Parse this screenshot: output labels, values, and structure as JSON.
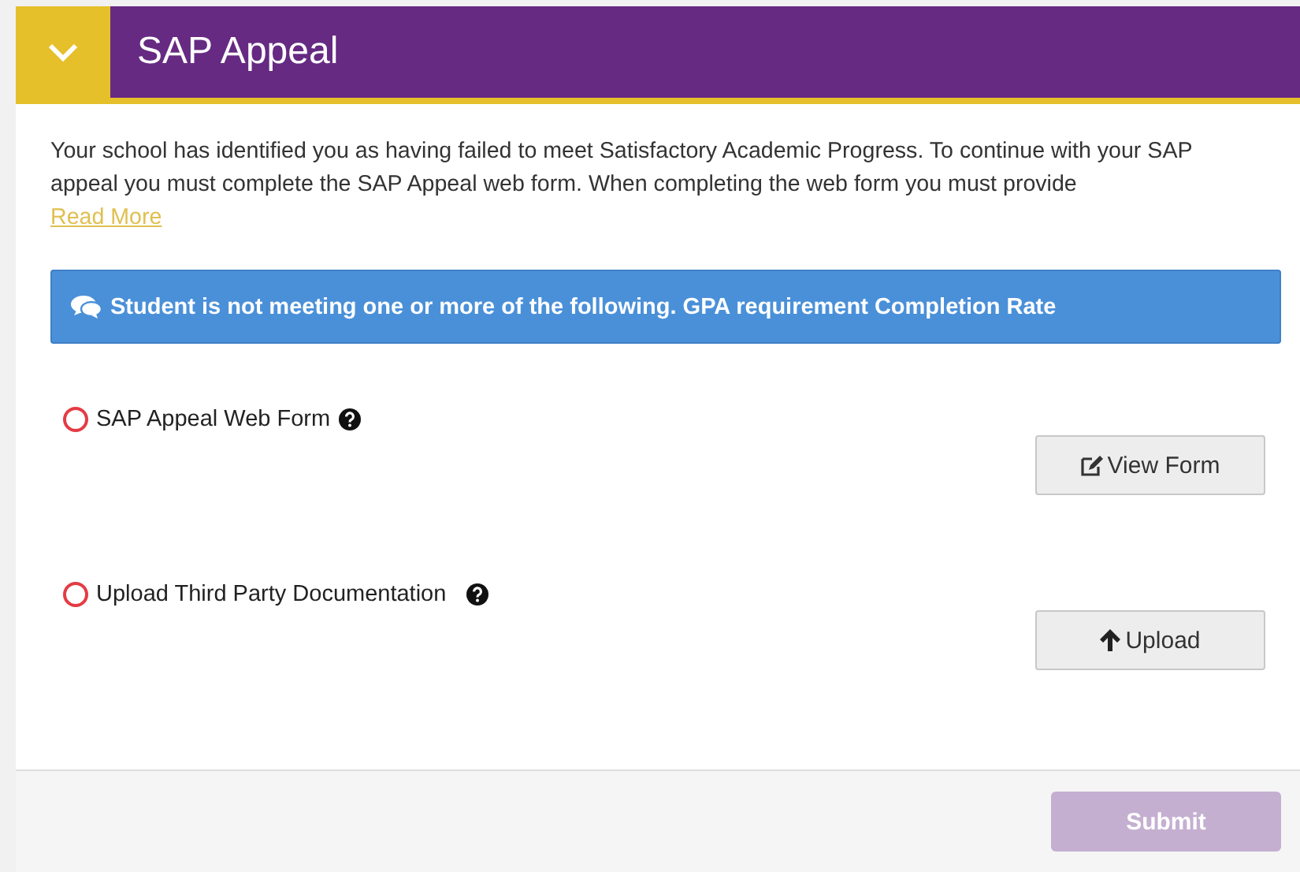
{
  "panel": {
    "title": "SAP Appeal",
    "expanded": true
  },
  "intro": {
    "text": "Your school has identified you as having failed to meet Satisfactory Academic Progress. To continue with your SAP appeal you must complete the SAP Appeal web form. When completing the web form you must provide",
    "link": "Read More"
  },
  "alert": {
    "text": "Student is not meeting one or more of the following. GPA requirement Completion Rate"
  },
  "tasks": [
    {
      "label": "SAP Appeal Web Form",
      "completed": false,
      "button": {
        "label": "View Form",
        "kind": "edit"
      }
    },
    {
      "label": "Upload Third Party Documentation",
      "completed": false,
      "button": {
        "label": "Upload",
        "kind": "upload"
      }
    }
  ],
  "footer": {
    "submit": {
      "label": "Submit",
      "disabled": true
    }
  }
}
